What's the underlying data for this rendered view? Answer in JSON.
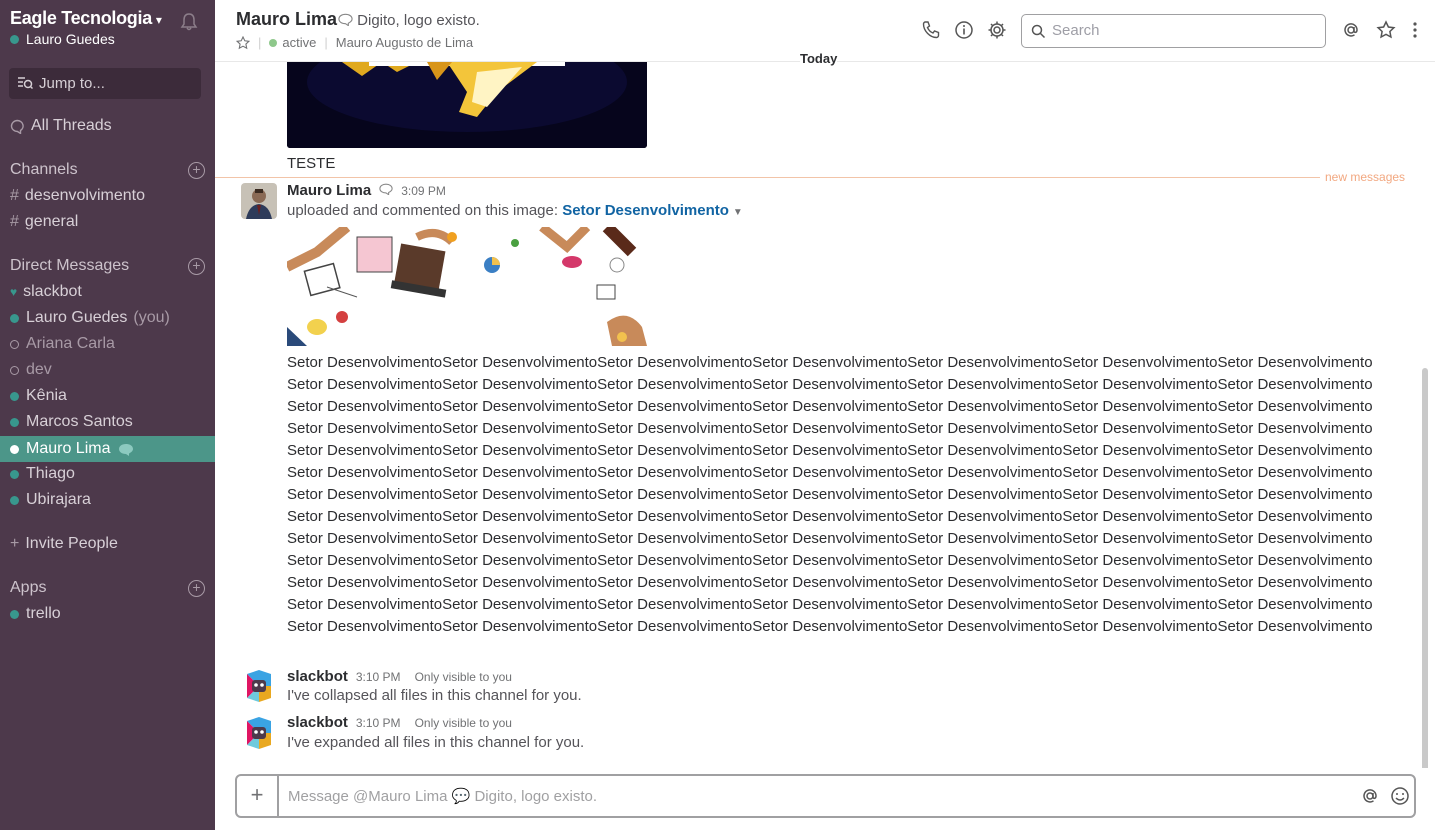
{
  "sidebar": {
    "team_name": "Eagle Tecnologia",
    "user_name": "Lauro Guedes",
    "jump_to": "Jump to...",
    "all_threads": "All Threads",
    "channels_heading": "Channels",
    "channels": [
      "desenvolvimento",
      "general"
    ],
    "dm_heading": "Direct Messages",
    "direct_messages": [
      {
        "name": "slackbot",
        "status": "bot"
      },
      {
        "name": "Lauro Guedes",
        "suffix": "(you)",
        "status": "online"
      },
      {
        "name": "Ariana Carla",
        "status": "away"
      },
      {
        "name": "dev",
        "status": "away"
      },
      {
        "name": "Kênia",
        "status": "online"
      },
      {
        "name": "Marcos Santos",
        "status": "online"
      },
      {
        "name": "Mauro Lima",
        "status": "active"
      },
      {
        "name": "Thiago",
        "status": "online"
      },
      {
        "name": "Ubirajara",
        "status": "online"
      }
    ],
    "invite_people": "Invite People",
    "apps_heading": "Apps",
    "apps": [
      "trello"
    ]
  },
  "header": {
    "title": "Mauro Lima",
    "status_text": "Digito, logo existo.",
    "presence": "active",
    "full_name": "Mauro Augusto de Lima",
    "search_placeholder": "Search"
  },
  "messages": {
    "date_divider": "Today",
    "prev_caption": "TESTE",
    "new_messages_label": "new messages",
    "upload": {
      "author": "Mauro Lima",
      "time": "3:09 PM",
      "action": "uploaded and commented on this image:",
      "file_name": "Setor Desenvolvimento",
      "comment": "Setor DesenvolvimentoSetor DesenvolvimentoSetor DesenvolvimentoSetor DesenvolvimentoSetor DesenvolvimentoSetor DesenvolvimentoSetor DesenvolvimentoSetor DesenvolvimentoSetor DesenvolvimentoSetor DesenvolvimentoSetor DesenvolvimentoSetor DesenvolvimentoSetor DesenvolvimentoSetor DesenvolvimentoSetor DesenvolvimentoSetor DesenvolvimentoSetor DesenvolvimentoSetor DesenvolvimentoSetor DesenvolvimentoSetor DesenvolvimentoSetor DesenvolvimentoSetor DesenvolvimentoSetor DesenvolvimentoSetor DesenvolvimentoSetor DesenvolvimentoSetor DesenvolvimentoSetor DesenvolvimentoSetor DesenvolvimentoSetor DesenvolvimentoSetor DesenvolvimentoSetor DesenvolvimentoSetor DesenvolvimentoSetor DesenvolvimentoSetor DesenvolvimentoSetor DesenvolvimentoSetor DesenvolvimentoSetor DesenvolvimentoSetor DesenvolvimentoSetor DesenvolvimentoSetor DesenvolvimentoSetor DesenvolvimentoSetor DesenvolvimentoSetor DesenvolvimentoSetor DesenvolvimentoSetor DesenvolvimentoSetor DesenvolvimentoSetor DesenvolvimentoSetor DesenvolvimentoSetor DesenvolvimentoSetor DesenvolvimentoSetor DesenvolvimentoSetor DesenvolvimentoSetor DesenvolvimentoSetor DesenvolvimentoSetor DesenvolvimentoSetor DesenvolvimentoSetor DesenvolvimentoSetor DesenvolvimentoSetor DesenvolvimentoSetor DesenvolvimentoSetor DesenvolvimentoSetor DesenvolvimentoSetor DesenvolvimentoSetor DesenvolvimentoSetor DesenvolvimentoSetor DesenvolvimentoSetor DesenvolvimentoSetor DesenvolvimentoSetor DesenvolvimentoSetor DesenvolvimentoSetor DesenvolvimentoSetor DesenvolvimentoSetor DesenvolvimentoSetor DesenvolvimentoSetor DesenvolvimentoSetor DesenvolvimentoSetor DesenvolvimentoSetor DesenvolvimentoSetor DesenvolvimentoSetor DesenvolvimentoSetor DesenvolvimentoSetor DesenvolvimentoSetor DesenvolvimentoSetor DesenvolvimentoSetor DesenvolvimentoSetor DesenvolvimentoSetor DesenvolvimentoSetor DesenvolvimentoSetor DesenvolvimentoSetor DesenvolvimentoSetor Desenvolvimento"
    },
    "bot1": {
      "author": "slackbot",
      "time": "3:10 PM",
      "visibility": "Only visible to you",
      "text": "I've collapsed all files in this channel for you."
    },
    "bot2": {
      "author": "slackbot",
      "time": "3:10 PM",
      "visibility": "Only visible to you",
      "text": "I've expanded all files in this channel for you."
    }
  },
  "composer": {
    "placeholder": "Message @Mauro Lima 💬 Digito, logo existo."
  },
  "colors": {
    "sidebar_bg": "#4d394b",
    "active_item": "#4c9689",
    "link": "#1164a3",
    "new_messages": "#f2a881"
  }
}
